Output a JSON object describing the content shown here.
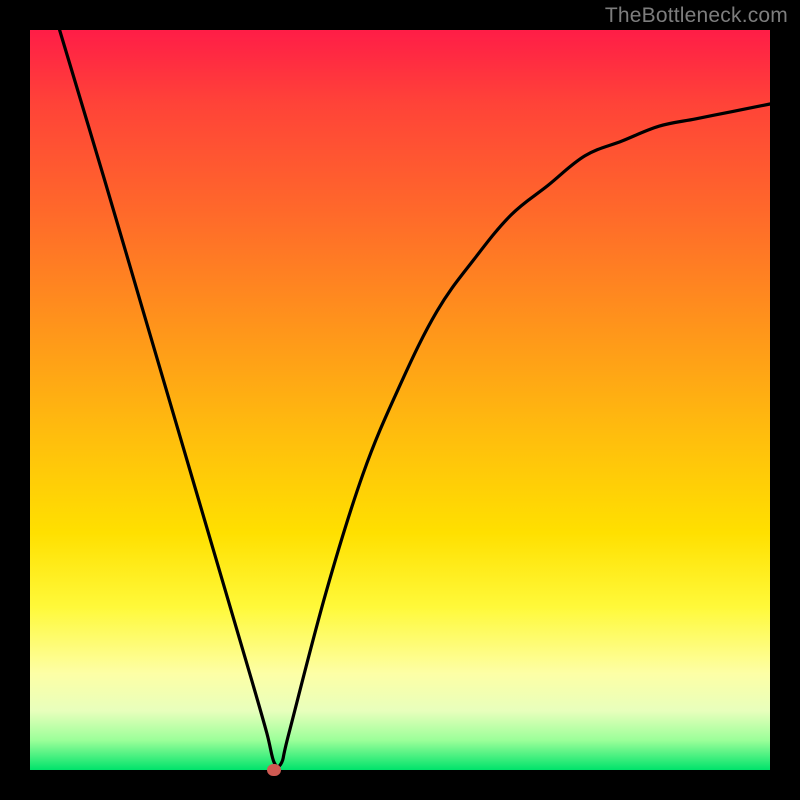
{
  "watermark": "TheBottleneck.com",
  "chart_data": {
    "type": "line",
    "title": "",
    "xlabel": "",
    "ylabel": "",
    "xlim": [
      0,
      100
    ],
    "ylim": [
      0,
      100
    ],
    "grid": false,
    "legend": false,
    "series": [
      {
        "name": "curve",
        "x": [
          4,
          10,
          15,
          20,
          25,
          30,
          32,
          33,
          34,
          35,
          40,
          45,
          50,
          55,
          60,
          65,
          70,
          75,
          80,
          85,
          90,
          95,
          100
        ],
        "y": [
          100,
          80,
          63,
          46,
          29,
          12,
          5,
          1,
          1,
          5,
          24,
          40,
          52,
          62,
          69,
          75,
          79,
          83,
          85,
          87,
          88,
          89,
          90
        ]
      }
    ],
    "marker": {
      "x_pct": 33,
      "y_pct": 0,
      "color": "#cf5a52"
    },
    "background_gradient": [
      "#ff1d47",
      "#ff6a2a",
      "#ffbe0d",
      "#fff93a",
      "#fdffa6",
      "#00e36b"
    ]
  }
}
